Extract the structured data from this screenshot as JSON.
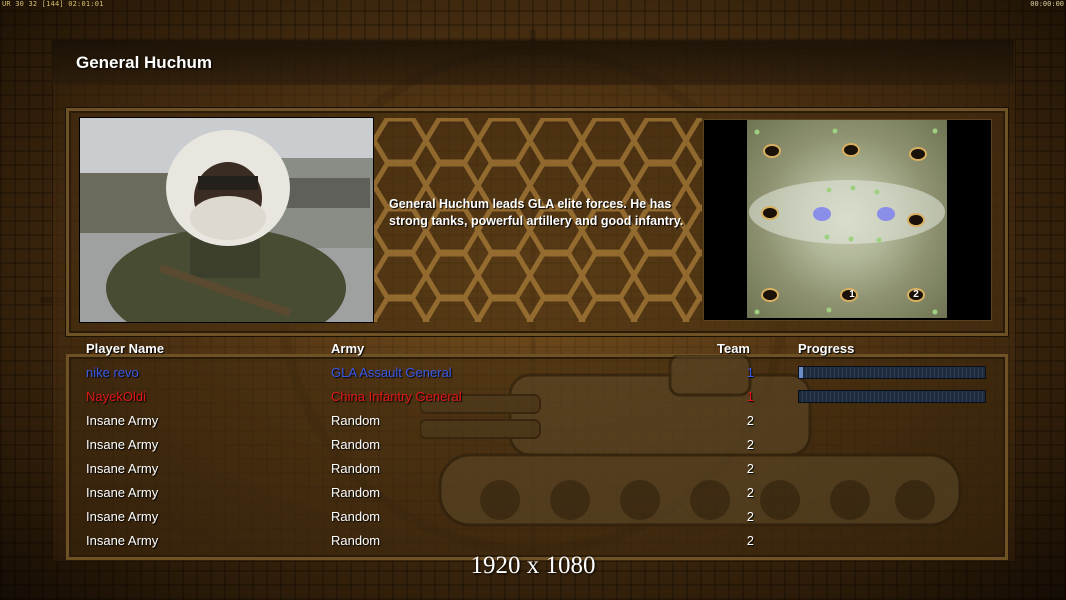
{
  "hud": {
    "left_status": "UR 30 32 [144] 02:01:01",
    "right_clock": "00:00:00"
  },
  "general": {
    "title": "General Huchum",
    "description": "General Huchum leads GLA elite forces. He has strong tanks, powerful artillery and good infantry."
  },
  "map": {
    "start_labels": [
      "1",
      "2"
    ]
  },
  "player_list": {
    "headers": {
      "player_name": "Player Name",
      "army": "Army",
      "team": "Team",
      "progress": "Progress"
    },
    "rows": [
      {
        "name": "nike revo",
        "army": "GLA Assault General",
        "team": "1",
        "color": "#3a5ae8",
        "progress": 0.02
      },
      {
        "name": "NayekOldi",
        "army": "China Infantry General",
        "team": "1",
        "color": "#e01818",
        "progress": 0.0
      },
      {
        "name": "Insane Army",
        "army": "Random",
        "team": "2",
        "color": "#ffffff"
      },
      {
        "name": "Insane Army",
        "army": "Random",
        "team": "2",
        "color": "#ffffff"
      },
      {
        "name": "Insane Army",
        "army": "Random",
        "team": "2",
        "color": "#ffffff"
      },
      {
        "name": "Insane Army",
        "army": "Random",
        "team": "2",
        "color": "#ffffff"
      },
      {
        "name": "Insane Army",
        "army": "Random",
        "team": "2",
        "color": "#ffffff"
      },
      {
        "name": "Insane Army",
        "army": "Random",
        "team": "2",
        "color": "#ffffff"
      }
    ]
  },
  "resolution_label": "1920 x 1080"
}
